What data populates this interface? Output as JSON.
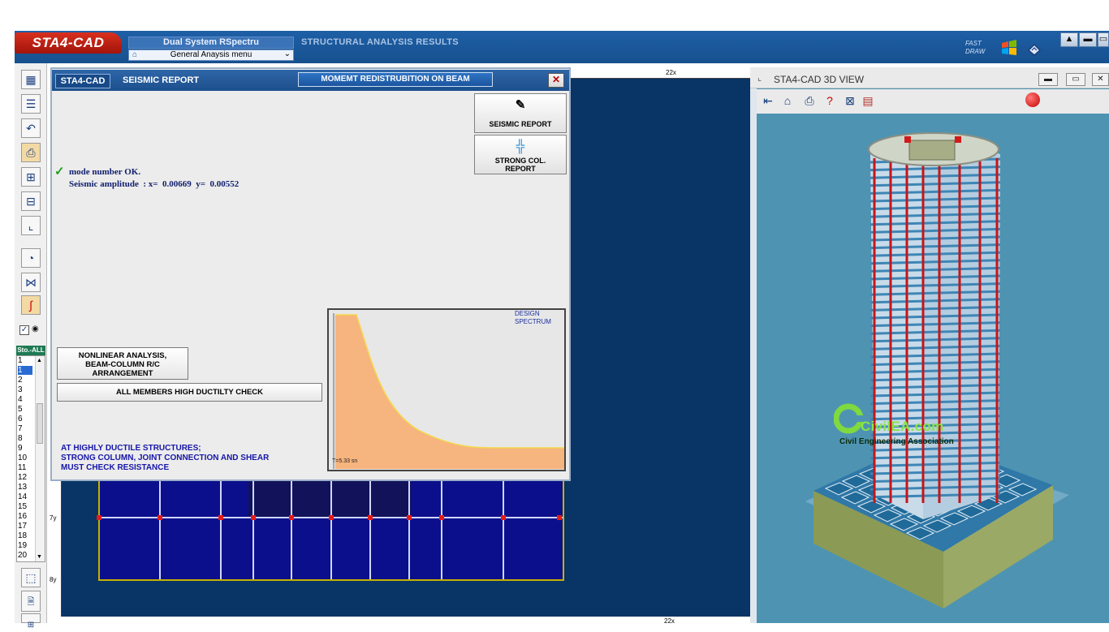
{
  "app": {
    "logo": "STA4-CAD",
    "system_title": "Dual System RSpectru",
    "menu_value": "General Anaysis menu",
    "results_title": "STRUCTURAL ANALYSIS RESULTS",
    "fast_draw_1": "FAST",
    "fast_draw_2": "DRAW"
  },
  "window_controls": {
    "minimize": "▬",
    "restore": "▭",
    "up": "▲"
  },
  "story_panel": {
    "header": "Sto.-ALL",
    "items": [
      "1",
      "1",
      "2",
      "3",
      "4",
      "5",
      "6",
      "7",
      "8",
      "9",
      "10",
      "11",
      "12",
      "13",
      "14",
      "15",
      "16",
      "17",
      "18",
      "19",
      "20"
    ]
  },
  "plan": {
    "top_axis_label": "22x",
    "left_axis_7": "7y",
    "left_axis_8": "8y",
    "bottom_axis_label": "22x"
  },
  "dialog": {
    "brand": "STA4-CAD",
    "title": "SEISMIC REPORT",
    "moment_button": "MOMEMT REDISTRUBITION ON BEAM",
    "close": "✕",
    "seismic_report_button": "SEISMIC REPORT",
    "strong_col_line1": "STRONG COL.",
    "strong_col_line2": "REPORT",
    "mode_status": "mode number  OK.",
    "seismic_amplitude": "Seismic amplitude  : x=  0.00669  y=  0.00552",
    "nonlinear_line1": "NONLINEAR ANALYSIS,",
    "nonlinear_line2": "BEAM-COLUMN R/C",
    "nonlinear_line3": "ARRANGEMENT",
    "ductility_button": "ALL MEMBERS HIGH DUCTILTY CHECK",
    "note_line1": "AT HIGHLY DUCTILE STRUCTURES;",
    "note_line2": "STRONG COLUMN, JOINT CONNECTION AND SHEAR",
    "note_line3": "MUST CHECK RESISTANCE",
    "spectrum_label_1": "DESIGN",
    "spectrum_label_2": "SPECTRUM",
    "spectrum_period": "T=5.33 sn",
    "fill_color": "#f6b47e",
    "line_color": "#f4d84a"
  },
  "view3d": {
    "title": "STA4-CAD  3D VIEW",
    "watermark": "CivilEA.com",
    "watermark_sub": "Civil Engineering Association",
    "bg_color": "#4e94b2"
  }
}
